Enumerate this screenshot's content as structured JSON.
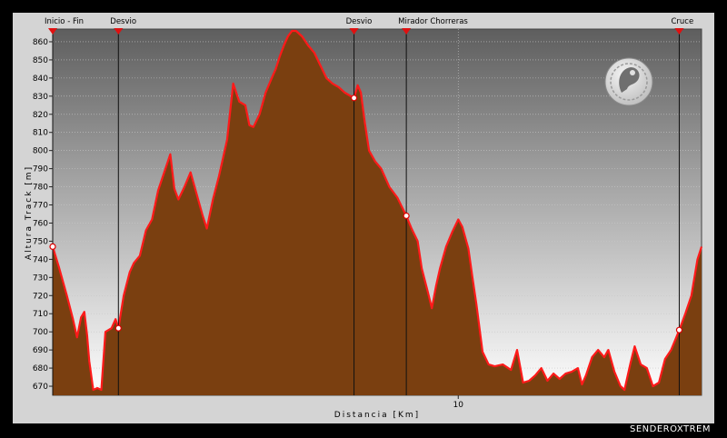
{
  "credit": "SENDEROXTREM",
  "chart_data": {
    "type": "area",
    "xlabel": "Distancia [Km]",
    "ylabel": "Altura Track [m]",
    "xlim": [
      0,
      16
    ],
    "ylim": [
      665,
      867
    ],
    "x_ticks": [
      10
    ],
    "y_ticks": [
      670,
      680,
      690,
      700,
      710,
      720,
      730,
      740,
      750,
      760,
      770,
      780,
      790,
      800,
      810,
      820,
      830,
      840,
      850,
      860
    ],
    "grid": true,
    "fill_color": "#7a3f10",
    "line_color": "#ff1a1a",
    "waypoints": [
      {
        "label": "Inicio - Fin",
        "x": 0.0
      },
      {
        "label": "Desvio",
        "x": 1.62
      },
      {
        "label": "Desvio",
        "x": 7.43
      },
      {
        "label": "Mirador Chorreras",
        "x": 8.72
      },
      {
        "label": "Cruce",
        "x": 15.45
      }
    ],
    "series": [
      {
        "x": [
          0.0,
          0.15,
          0.35,
          0.5,
          0.6,
          0.7,
          0.78,
          0.85,
          0.9,
          1.0,
          1.1,
          1.2,
          1.3,
          1.45,
          1.55,
          1.62,
          1.75,
          1.9,
          2.0,
          2.15,
          2.3,
          2.45,
          2.6,
          2.75,
          2.9,
          3.0,
          3.1,
          3.25,
          3.4,
          3.55,
          3.7,
          3.8,
          3.95,
          4.1,
          4.3,
          4.45,
          4.6,
          4.75,
          4.85,
          4.95,
          5.1,
          5.25,
          5.4,
          5.5,
          5.6,
          5.7,
          5.8,
          5.9,
          6.0,
          6.15,
          6.3,
          6.45,
          6.6,
          6.75,
          6.9,
          7.05,
          7.2,
          7.35,
          7.43,
          7.52,
          7.6,
          7.7,
          7.8,
          7.95,
          8.1,
          8.3,
          8.5,
          8.72,
          8.85,
          9.0,
          9.1,
          9.25,
          9.35,
          9.45,
          9.55,
          9.7,
          9.85,
          10.0,
          10.1,
          10.25,
          10.35,
          10.45,
          10.6,
          10.75,
          10.9,
          11.1,
          11.3,
          11.45,
          11.6,
          11.75,
          11.9,
          12.05,
          12.2,
          12.35,
          12.5,
          12.65,
          12.8,
          12.95,
          13.05,
          13.15,
          13.3,
          13.45,
          13.6,
          13.7,
          13.85,
          14.0,
          14.1,
          14.25,
          14.35,
          14.5,
          14.65,
          14.8,
          14.95,
          15.1,
          15.25,
          15.45,
          15.6,
          15.75,
          15.9,
          16.0
        ],
        "y": [
          747,
          736,
          720,
          707,
          697,
          708,
          711,
          698,
          684,
          668,
          669,
          668,
          700,
          702,
          707,
          702,
          720,
          733,
          738,
          742,
          756,
          762,
          778,
          788,
          798,
          779,
          773,
          780,
          788,
          776,
          764,
          757,
          773,
          786,
          806,
          837,
          827,
          825,
          814,
          813,
          820,
          832,
          840,
          845,
          852,
          858,
          863,
          866,
          866,
          863,
          858,
          854,
          847,
          840,
          837,
          835,
          832,
          830,
          829,
          836,
          832,
          815,
          800,
          794,
          790,
          780,
          774,
          764,
          757,
          750,
          735,
          722,
          713,
          725,
          735,
          747,
          755,
          762,
          758,
          746,
          730,
          715,
          689,
          682,
          681,
          682,
          679,
          690,
          672,
          673,
          676,
          680,
          673,
          677,
          674,
          677,
          678,
          680,
          671,
          676,
          686,
          690,
          686,
          690,
          678,
          670,
          668,
          683,
          692,
          682,
          680,
          670,
          672,
          685,
          690,
          701,
          710,
          720,
          740,
          747
        ]
      }
    ]
  }
}
